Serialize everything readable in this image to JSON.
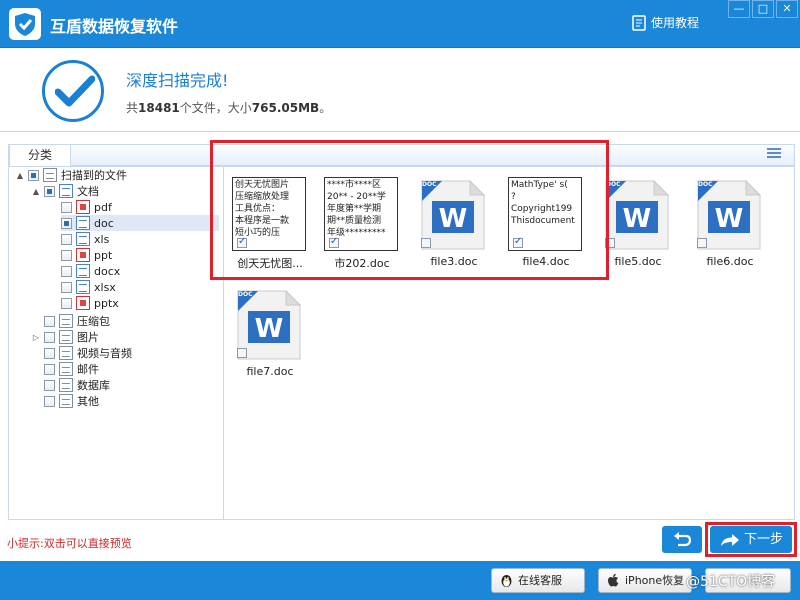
{
  "titlebar": {
    "app_title": "互盾数据恢复软件",
    "help_label": "使用教程",
    "minimize_label": "—",
    "maximize_label": "□",
    "close_label": "✕"
  },
  "status": {
    "title": "深度扫描完成!",
    "summary_prefix": "共",
    "file_count": "18481",
    "summary_middle": "个文件，大小",
    "total_size": "765.05MB",
    "summary_suffix": "。"
  },
  "tabs": {
    "category_label": "分类"
  },
  "tree": {
    "root": "扫描到的文件",
    "documents": "文档",
    "doc_types": [
      "pdf",
      "doc",
      "xls",
      "ppt",
      "docx",
      "xlsx",
      "pptx"
    ],
    "categories": [
      "压缩包",
      "图片",
      "视频与音频",
      "邮件",
      "数据库",
      "其他"
    ]
  },
  "files": [
    {
      "name": "创天无忧图...",
      "preview": [
        "创天无忧图片",
        "压缩缩放处理",
        "工具优点：",
        "本程序是一款",
        "短小巧的压"
      ],
      "checked": true
    },
    {
      "name": "市202.doc",
      "preview": [
        "****市****区",
        "20** - 20**学",
        "年度第**学期",
        "期**质量检测",
        "年级*********"
      ],
      "checked": true
    },
    {
      "name": "file3.doc",
      "preview": [],
      "checked": false
    },
    {
      "name": "file4.doc",
      "preview": [
        "MathType' s(",
        "?",
        "Copyright199",
        "Thisdocument"
      ],
      "checked": true
    },
    {
      "name": "file5.doc",
      "preview": [],
      "checked": false
    },
    {
      "name": "file6.doc",
      "preview": [],
      "checked": false
    },
    {
      "name": "file7.doc",
      "preview": [],
      "checked": false
    }
  ],
  "doc_badge": "DOC",
  "footer": {
    "hint": "小提示:双击可以直接预览",
    "next_label": "下一步",
    "online_service": "在线客服",
    "iphone_recovery": "iPhone恢复",
    "third_service": "",
    "watermark": "@51CTO博客"
  },
  "colors": {
    "primary": "#1a87d8",
    "highlight": "#e0202a",
    "hint": "#d02828"
  }
}
